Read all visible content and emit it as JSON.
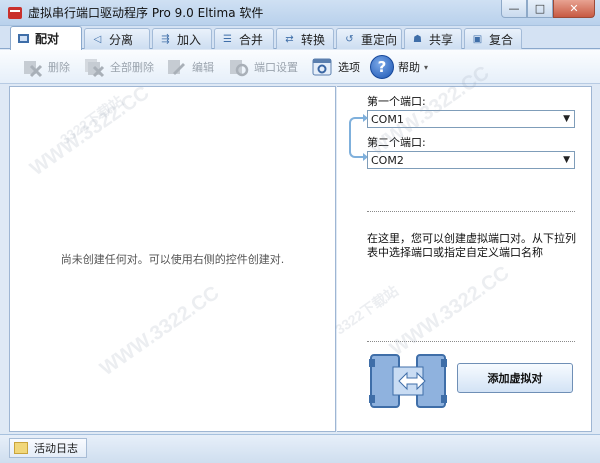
{
  "window": {
    "title": "虚拟串行端口驱动程序 Pro 9.0 Eltima 软件",
    "min_glyph": "—",
    "restore_glyph": "□",
    "close_glyph": "✕"
  },
  "tabs": [
    {
      "label": "配对",
      "icon": "pair-icon",
      "active": true
    },
    {
      "label": "分离",
      "icon": "split-icon"
    },
    {
      "label": "加入",
      "icon": "join-icon"
    },
    {
      "label": "合并",
      "icon": "merge-icon"
    },
    {
      "label": "转换",
      "icon": "convert-icon"
    },
    {
      "label": "重定向",
      "icon": "redirect-icon"
    },
    {
      "label": "共享",
      "icon": "share-icon"
    },
    {
      "label": "复合",
      "icon": "composite-icon"
    }
  ],
  "toolbar": {
    "delete": "删除",
    "delete_all": "全部删除",
    "edit": "编辑",
    "port_settings": "端口设置",
    "options": "选项",
    "help": "帮助",
    "help_glyph": "?",
    "caret_glyph": "▾"
  },
  "left": {
    "empty_message": "尚未创建任何对。可以使用右侧的控件创建对."
  },
  "right": {
    "first_port_label": "第一个端口:",
    "first_port_value": "COM1",
    "second_port_label": "第二个端口:",
    "second_port_value": "COM2",
    "dropdown_glyph": "▼",
    "info_text": "在这里，您可以创建虚拟端口对。从下拉列表中选择端口或指定自定义端口名称",
    "add_button": "添加虚拟对"
  },
  "status": {
    "log_tab": "活动日志"
  },
  "watermark": "WWW.3322.CC",
  "watermark_cn": "3322下载站"
}
